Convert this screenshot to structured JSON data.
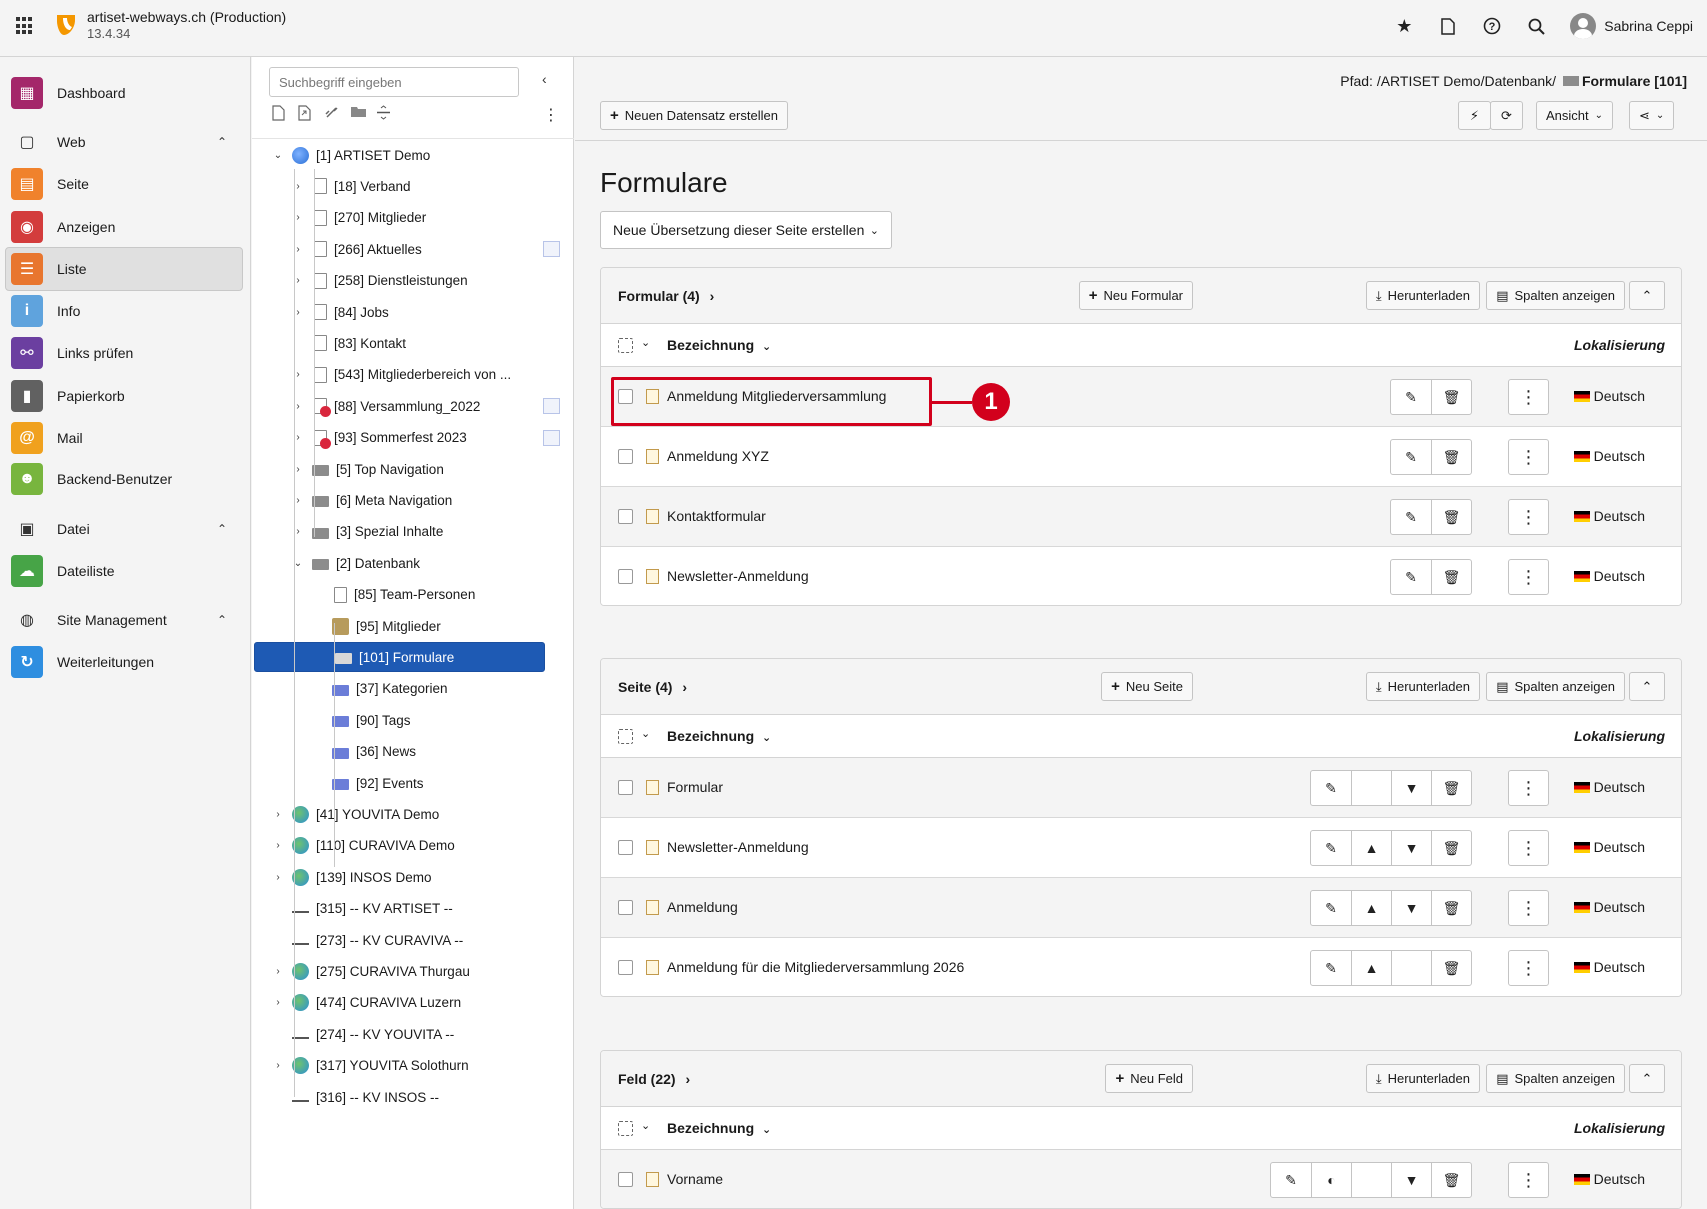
{
  "topbar": {
    "site_name": "artiset-webways.ch (Production)",
    "version": "13.4.34",
    "user_name": "Sabrina Ceppi",
    "icons": [
      "star-icon",
      "file-icon",
      "help-icon",
      "search-icon",
      "user-avatar-icon"
    ]
  },
  "modulemenu": {
    "items": [
      {
        "label": "Dashboard",
        "icon": "dashboard-icon",
        "color": "#a4276a",
        "type": "module"
      },
      {
        "label": "Web",
        "icon": "web-icon",
        "type": "group"
      },
      {
        "label": "Seite",
        "icon": "page-icon",
        "color": "#f0822c",
        "type": "module"
      },
      {
        "label": "Anzeigen",
        "icon": "eye-icon",
        "color": "#d33c3c",
        "type": "module"
      },
      {
        "label": "Liste",
        "icon": "list-icon",
        "color": "#e8762f",
        "type": "module",
        "active": true
      },
      {
        "label": "Info",
        "icon": "info-icon",
        "color": "#5fa3dd",
        "type": "module"
      },
      {
        "label": "Links prüfen",
        "icon": "link-icon",
        "color": "#6b3fa0",
        "type": "module"
      },
      {
        "label": "Papierkorb",
        "icon": "trash-icon",
        "color": "#616161",
        "type": "module"
      },
      {
        "label": "Mail",
        "icon": "mail-icon",
        "color": "#f0a11e",
        "type": "module"
      },
      {
        "label": "Backend-Benutzer",
        "icon": "users-icon",
        "color": "#78b53e",
        "type": "module"
      },
      {
        "label": "Datei",
        "icon": "image-icon",
        "type": "group"
      },
      {
        "label": "Dateiliste",
        "icon": "cloud-icon",
        "color": "#47a447",
        "type": "module"
      },
      {
        "label": "Site Management",
        "icon": "globe-icon",
        "type": "group"
      },
      {
        "label": "Weiterleitungen",
        "icon": "redirect-icon",
        "color": "#2e8ee0",
        "type": "module"
      }
    ]
  },
  "tree": {
    "search_placeholder": "Suchbegriff eingeben",
    "nodes": [
      {
        "label": "[1] ARTISET Demo",
        "icon": "globe-blue",
        "depth": 0,
        "expanded": true
      },
      {
        "label": "[18] Verband",
        "icon": "page",
        "depth": 1,
        "chevron": true
      },
      {
        "label": "[270] Mitglieder",
        "icon": "page",
        "depth": 1,
        "chevron": true
      },
      {
        "label": "[266] Aktuelles",
        "icon": "page",
        "depth": 1,
        "chevron": true,
        "mark": true
      },
      {
        "label": "[258] Dienstleistungen",
        "icon": "page",
        "depth": 1,
        "chevron": true
      },
      {
        "label": "[84] Jobs",
        "icon": "page",
        "depth": 1,
        "chevron": true
      },
      {
        "label": "[83] Kontakt",
        "icon": "page",
        "depth": 1
      },
      {
        "label": "[543] Mitgliederbereich von ...",
        "icon": "page-blue",
        "depth": 1,
        "chevron": true
      },
      {
        "label": "[88] Versammlung_2022",
        "icon": "page-stop",
        "depth": 1,
        "chevron": true,
        "mark": true
      },
      {
        "label": "[93] Sommerfest 2023",
        "icon": "page-stop",
        "depth": 1,
        "chevron": true,
        "mark": true
      },
      {
        "label": "[5] Top Navigation",
        "icon": "folder",
        "depth": 1,
        "chevron": true
      },
      {
        "label": "[6] Meta Navigation",
        "icon": "folder",
        "depth": 1,
        "chevron": true
      },
      {
        "label": "[3] Spezial Inhalte",
        "icon": "folder",
        "depth": 1,
        "chevron": true
      },
      {
        "label": "[2] Datenbank",
        "icon": "folder",
        "depth": 1,
        "expanded": true
      },
      {
        "label": "[85] Team-Personen",
        "icon": "page",
        "depth": 2
      },
      {
        "label": "[95] Mitglieder",
        "icon": "mitglied",
        "depth": 2
      },
      {
        "label": "[101] Formulare",
        "icon": "folder",
        "depth": 2,
        "selected": true
      },
      {
        "label": "[37] Kategorien",
        "icon": "folder-blue",
        "depth": 2
      },
      {
        "label": "[90] Tags",
        "icon": "folder-blue",
        "depth": 2
      },
      {
        "label": "[36] News",
        "icon": "folder-blue",
        "depth": 2
      },
      {
        "label": "[92] Events",
        "icon": "folder-blue",
        "depth": 2
      },
      {
        "label": "[41] YOUVITA Demo",
        "icon": "globe",
        "depth": 0,
        "chevron": true
      },
      {
        "label": "[110] CURAVIVA Demo",
        "icon": "globe",
        "depth": 0,
        "chevron": true
      },
      {
        "label": "[139] INSOS Demo",
        "icon": "globe",
        "depth": 0,
        "chevron": true
      },
      {
        "label": "[315] -- KV ARTISET --",
        "icon": "sep",
        "depth": 0
      },
      {
        "label": "[273] -- KV CURAVIVA --",
        "icon": "sep",
        "depth": 0
      },
      {
        "label": "[275] CURAVIVA Thurgau",
        "icon": "globe",
        "depth": 0,
        "chevron": true
      },
      {
        "label": "[474] CURAVIVA Luzern",
        "icon": "globe",
        "depth": 0,
        "chevron": true
      },
      {
        "label": "[274] -- KV YOUVITA --",
        "icon": "sep",
        "depth": 0
      },
      {
        "label": "[317] YOUVITA Solothurn",
        "icon": "globe",
        "depth": 0,
        "chevron": true
      },
      {
        "label": "[316] -- KV INSOS --",
        "icon": "sep",
        "depth": 0
      }
    ]
  },
  "docheader": {
    "path_prefix": "Pfad: /ARTISET Demo/Datenbank/",
    "path_current": "Formulare [101]",
    "new_record": "Neuen Datensatz erstellen",
    "view": "Ansicht"
  },
  "main": {
    "title": "Formulare",
    "translation_select": "Neue Übersetzung dieser Seite erstellen",
    "col_name": "Bezeichnung",
    "col_loc": "Lokalisierung",
    "download": "Herunterladen",
    "show_columns": "Spalten anzeigen",
    "language": "Deutsch",
    "tables": [
      {
        "title": "Formular (4)",
        "new_label": "Neu Formular",
        "rows": [
          {
            "name": "Anmeldung Mitgliederversammlung",
            "buttons": [
              "edit",
              "delete"
            ]
          },
          {
            "name": "Anmeldung XYZ",
            "buttons": [
              "edit",
              "delete"
            ]
          },
          {
            "name": "Kontaktformular",
            "buttons": [
              "edit",
              "delete"
            ]
          },
          {
            "name": "Newsletter-Anmeldung",
            "buttons": [
              "edit",
              "delete"
            ]
          }
        ]
      },
      {
        "title": "Seite (4)",
        "new_label": "Neu Seite",
        "rows": [
          {
            "name": "Formular",
            "buttons": [
              "edit",
              "blank",
              "down",
              "delete"
            ]
          },
          {
            "name": "Newsletter-Anmeldung",
            "buttons": [
              "edit",
              "up",
              "down",
              "delete"
            ]
          },
          {
            "name": "Anmeldung",
            "buttons": [
              "edit",
              "up",
              "down",
              "delete"
            ]
          },
          {
            "name": "Anmeldung für die Mitgliederversammlung 2026",
            "buttons": [
              "edit",
              "up",
              "blank",
              "delete"
            ]
          }
        ]
      },
      {
        "title": "Feld (22)",
        "new_label": "Neu Feld",
        "rows": [
          {
            "name": "Vorname",
            "buttons": [
              "edit",
              "toggle",
              "blank",
              "down",
              "delete"
            ]
          }
        ]
      }
    ]
  },
  "annotation": {
    "number": "1"
  }
}
